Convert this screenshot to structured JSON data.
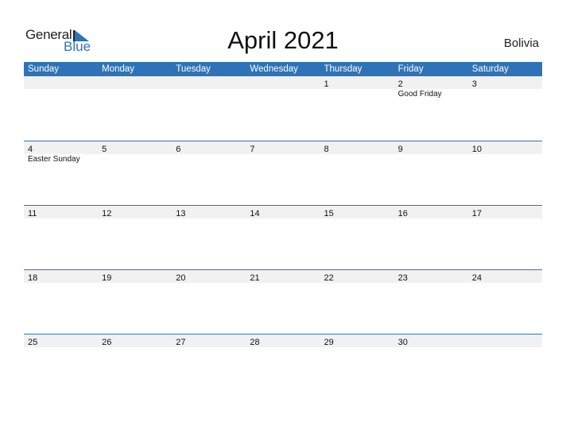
{
  "logo": {
    "general": "General",
    "blue": "Blue"
  },
  "title": "April 2021",
  "country": "Bolivia",
  "colors": {
    "accent": "#2e73b8",
    "strip": "#f1f1f1"
  },
  "weekdays": [
    "Sunday",
    "Monday",
    "Tuesday",
    "Wednesday",
    "Thursday",
    "Friday",
    "Saturday"
  ],
  "weeks": [
    {
      "days": [
        "",
        "",
        "",
        "",
        "1",
        "2",
        "3"
      ],
      "events": [
        "",
        "",
        "",
        "",
        "",
        "Good Friday",
        ""
      ]
    },
    {
      "days": [
        "4",
        "5",
        "6",
        "7",
        "8",
        "9",
        "10"
      ],
      "events": [
        "Easter Sunday",
        "",
        "",
        "",
        "",
        "",
        ""
      ]
    },
    {
      "days": [
        "11",
        "12",
        "13",
        "14",
        "15",
        "16",
        "17"
      ],
      "events": [
        "",
        "",
        "",
        "",
        "",
        "",
        ""
      ]
    },
    {
      "days": [
        "18",
        "19",
        "20",
        "21",
        "22",
        "23",
        "24"
      ],
      "events": [
        "",
        "",
        "",
        "",
        "",
        "",
        ""
      ]
    },
    {
      "days": [
        "25",
        "26",
        "27",
        "28",
        "29",
        "30",
        ""
      ],
      "events": [
        "",
        "",
        "",
        "",
        "",
        "",
        ""
      ]
    }
  ]
}
